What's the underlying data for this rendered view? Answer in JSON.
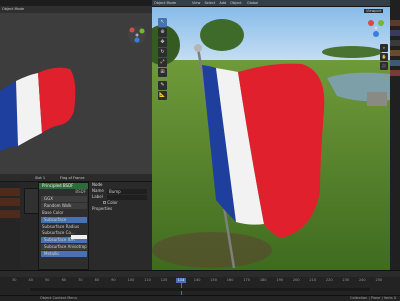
{
  "top_bar": {
    "left_view_mode": "Object Mode",
    "menu": [
      "View",
      "Select",
      "Add",
      "Object"
    ],
    "right_view_mode": "Object Mode",
    "right_menu": [
      "View",
      "Select",
      "Add",
      "Object"
    ],
    "global_label": "Global",
    "camera_label": "Camera"
  },
  "node_editor": {
    "header_item": "Flag of France",
    "slot": "Slot 1",
    "principled": {
      "title": "Principled BSDF",
      "bsdf_label": "BSDF"
    },
    "rows": [
      "GGX",
      "Random Walk",
      "Base Color",
      "Subsurface",
      "Subsurface Radius",
      "Subsurface Co...",
      "Subsurface IOR",
      "Subsurface Anisotropy",
      "Metallic"
    ],
    "color_node": {
      "rows": [
        "Color",
        "Alpha"
      ]
    },
    "side_panel": {
      "title": "Node",
      "name_label": "Name",
      "name_value": "Bump",
      "label_label": "Label",
      "color_label": "Color",
      "properties_label": "Properties"
    }
  },
  "viewport_right": {
    "viewport_label": "Viewport"
  },
  "timeline": {
    "frame_labels": [
      "30",
      "40",
      "50",
      "60",
      "70",
      "80",
      "90",
      "100",
      "110",
      "120",
      "130",
      "140",
      "150",
      "160",
      "170",
      "180",
      "190",
      "200",
      "210",
      "220",
      "230",
      "240",
      "250"
    ],
    "current_frame": "114",
    "status_left": "Object Context Menu",
    "status_right": "Collection | Plane | Verts 0"
  },
  "colors": {
    "flag_blue": "#1e3f9e",
    "flag_white": "#f2f2f2",
    "flag_red": "#e1202e",
    "accent_blue": "#4772b3",
    "node_green": "#2f6a3a",
    "node_purple": "#633d7c"
  }
}
